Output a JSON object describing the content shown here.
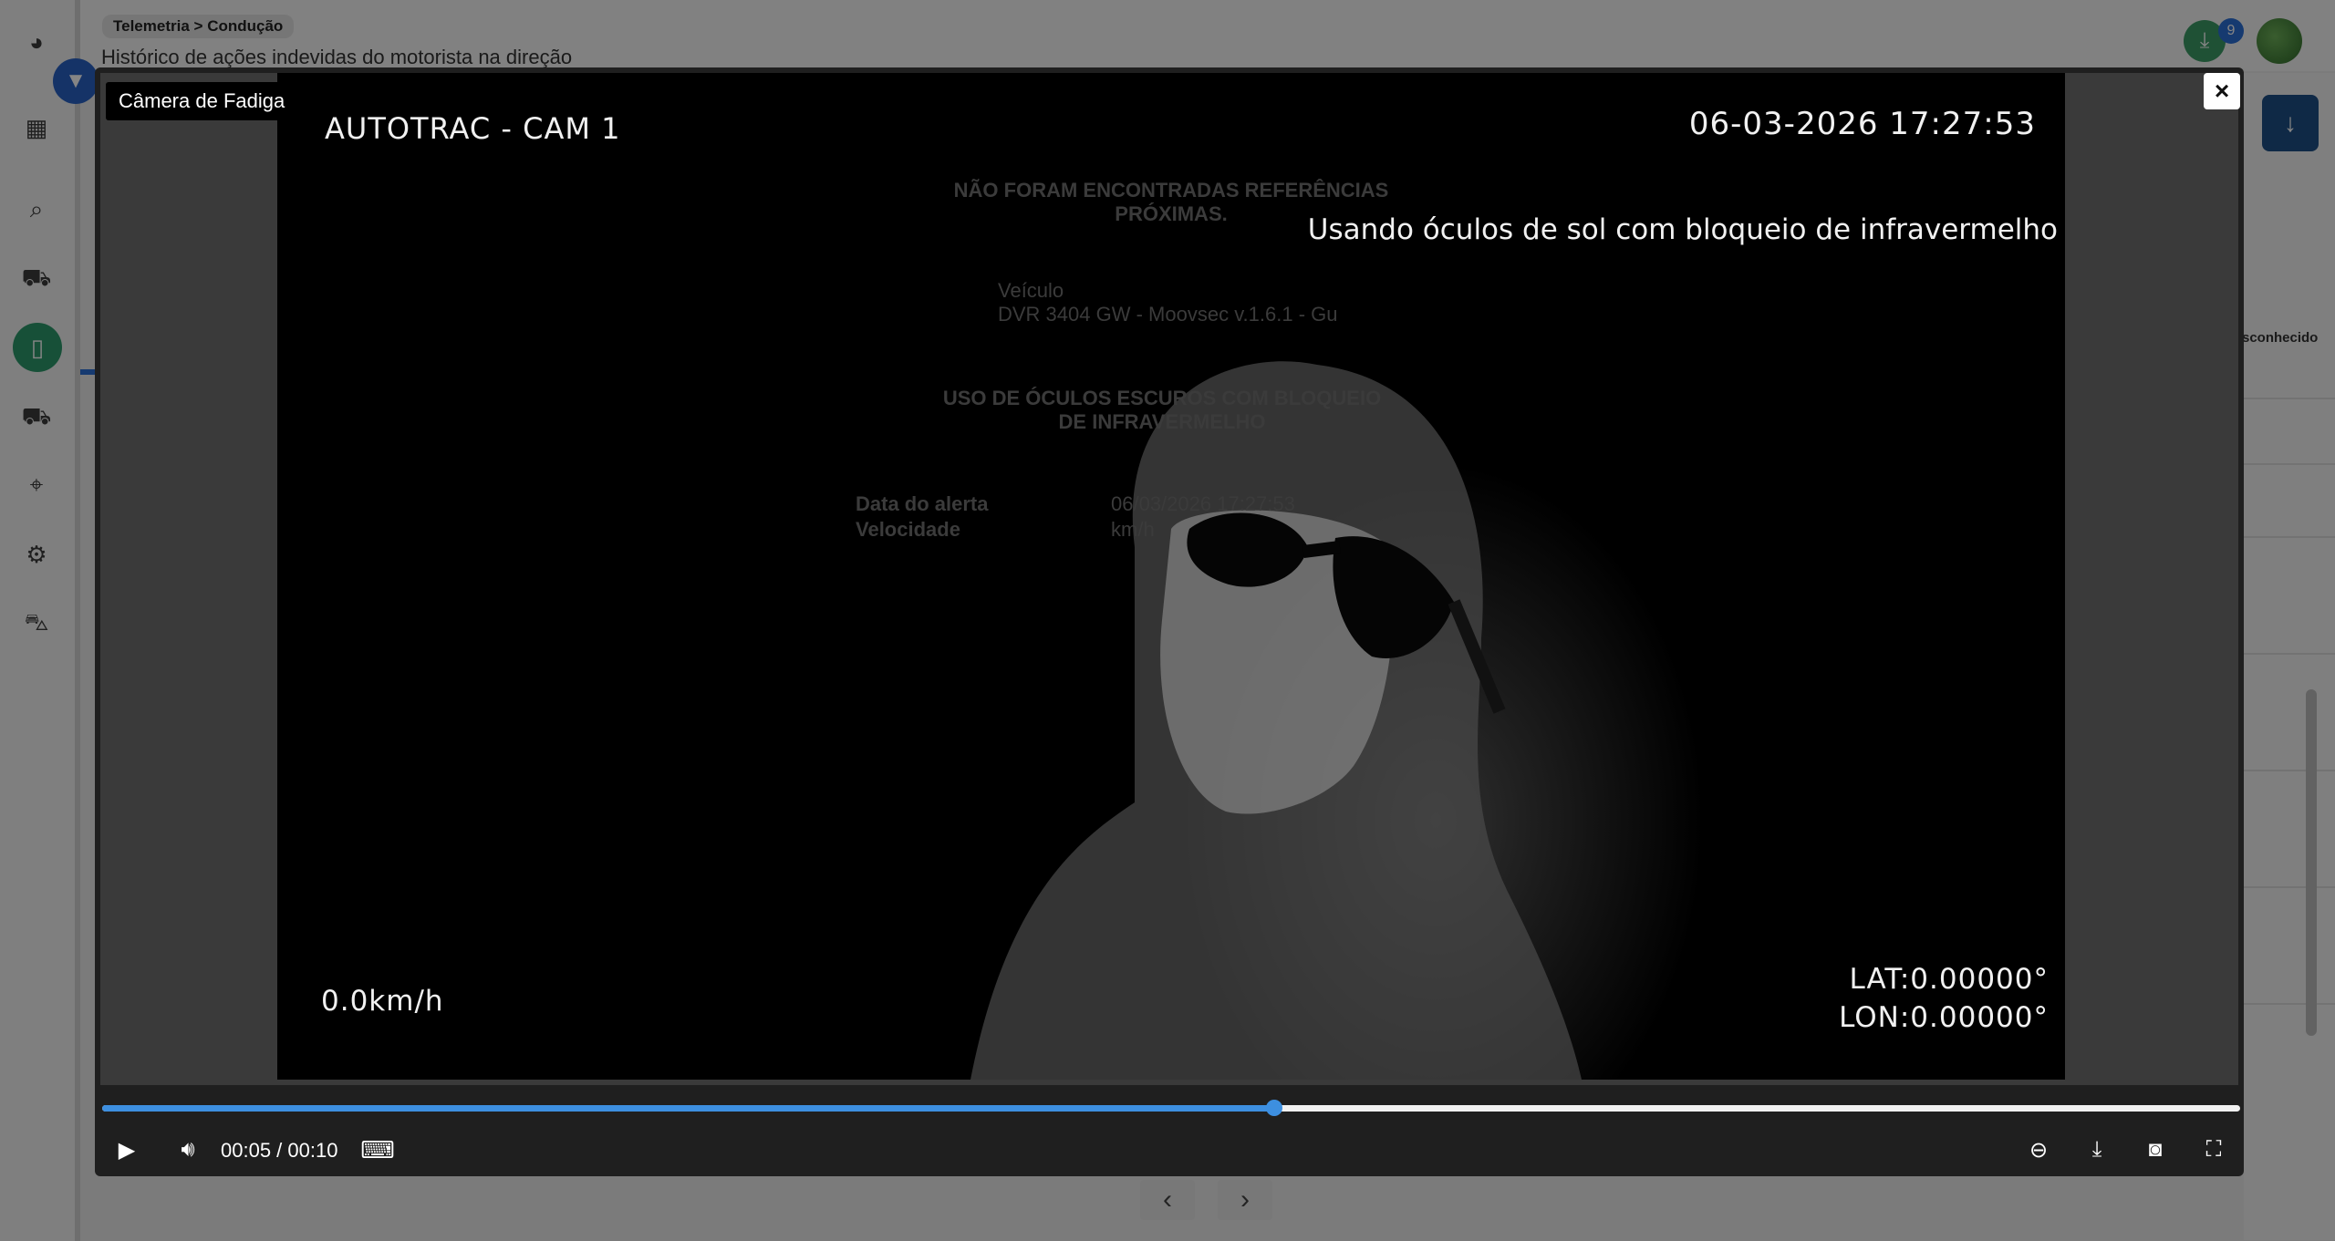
{
  "header": {
    "breadcrumb_root": "Telemetria",
    "breadcrumb_sep": ">",
    "breadcrumb_current": "Condução",
    "subtitle": "Histórico de ações indevidas do motorista na direção",
    "downloads_count": "9"
  },
  "sidebar": {
    "items": [
      {
        "icon": "pie-chart-icon",
        "glyph": "◕"
      },
      {
        "icon": "map-icon",
        "glyph": "▦"
      },
      {
        "icon": "search-icon",
        "glyph": "⌕"
      },
      {
        "icon": "car-icon",
        "glyph": "⛟"
      },
      {
        "icon": "phone-icon",
        "glyph": "▯",
        "active": true
      },
      {
        "icon": "truck-icon",
        "glyph": "⛟"
      },
      {
        "icon": "crosshair-icon",
        "glyph": "⌖"
      },
      {
        "icon": "gears-icon",
        "glyph": "⚙"
      },
      {
        "icon": "vehicle-icon",
        "glyph": "⛍"
      }
    ]
  },
  "right_panel": {
    "label": "sconhecido"
  },
  "modal": {
    "tooltip": "Câmera de Fadiga",
    "close_label": "×",
    "video": {
      "cam_label": "AUTOTRAC - CAM 1",
      "timestamp": "06-03-2026  17:27:53",
      "event_text": "Usando óculos de sol com bloqueio de infravermelho",
      "speed": "0.0km/h",
      "lat": "LAT:0.00000°",
      "lon": "LON:0.00000°"
    },
    "ghost": {
      "no_refs": "NÃO FORAM ENCONTRADAS REFERÊNCIAS PRÓXIMAS.",
      "vehicle_label": "Veículo",
      "vehicle_value": "DVR 3404 GW - Moovsec v.1.6.1 - Gu",
      "alert_title": "USO DE ÓCULOS ESCUROS COM BLOQUEIO DE INFRAVERMELHO",
      "date_label": "Data do alerta",
      "date_value": "06/03/2026 17:27:53",
      "speed_label": "Velocidade",
      "speed_value": "km/h"
    },
    "player": {
      "current_time": "00:05",
      "duration": "00:10",
      "time_display": "00:05 / 00:10",
      "progress": 0.548
    }
  }
}
